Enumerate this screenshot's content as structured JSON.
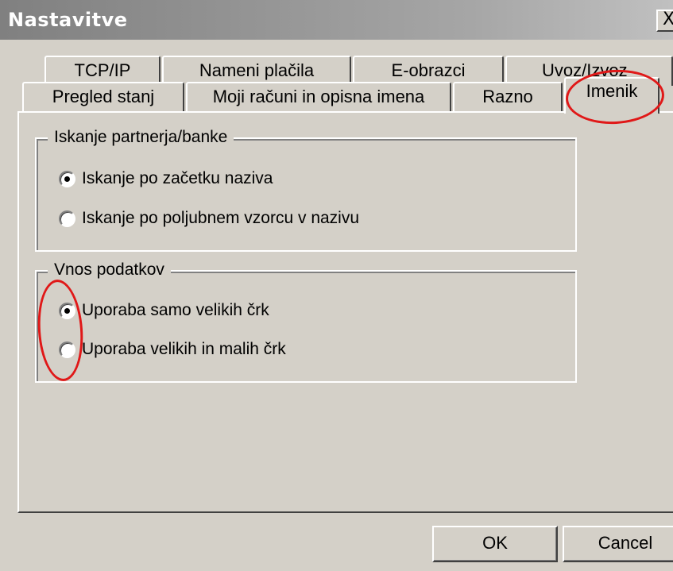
{
  "window": {
    "title": "Nastavitve",
    "close_glyph": "X"
  },
  "tabs": {
    "row_back": [
      {
        "label": "TCP/IP"
      },
      {
        "label": "Nameni plačila"
      },
      {
        "label": "E-obrazci"
      },
      {
        "label": "Uvoz/Izvoz"
      }
    ],
    "row_front": [
      {
        "label": "Pregled stanj"
      },
      {
        "label": "Moji računi in opisna imena"
      },
      {
        "label": "Razno"
      },
      {
        "label": "Imenik",
        "active": true
      }
    ]
  },
  "groups": {
    "search": {
      "legend": "Iskanje partnerja/banke",
      "options": [
        {
          "label": "Iskanje po začetku naziva",
          "checked": true
        },
        {
          "label": "Iskanje po poljubnem vzorcu v nazivu",
          "checked": false
        }
      ]
    },
    "entry": {
      "legend": "Vnos podatkov",
      "options": [
        {
          "label": "Uporaba samo velikih črk",
          "checked": true
        },
        {
          "label": "Uporaba velikih in malih črk",
          "checked": false
        }
      ]
    }
  },
  "buttons": {
    "ok": "OK",
    "cancel": "Cancel"
  },
  "colors": {
    "dialog_bg": "#d4d0c8",
    "annotation": "#e01818"
  }
}
